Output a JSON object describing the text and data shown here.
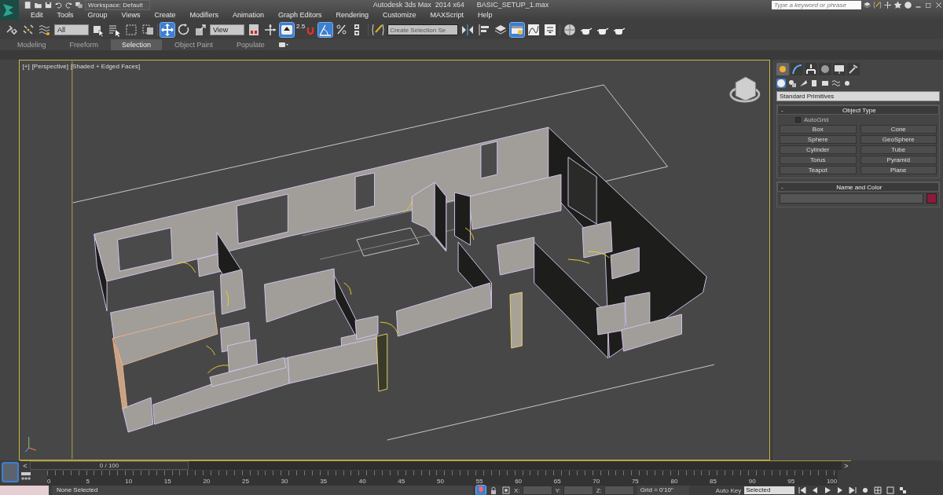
{
  "title_bar": {
    "workspace": "Workspace: Default",
    "app_title": "Autodesk 3ds Max  2014 x64",
    "file_name": "BASIC_SETUP_1.max",
    "search": {
      "placeholder": "Type a keyword or phrase"
    }
  },
  "menu": [
    "Edit",
    "Tools",
    "Group",
    "Views",
    "Create",
    "Modifiers",
    "Animation",
    "Graph Editors",
    "Rendering",
    "Customize",
    "MAXScript",
    "Help"
  ],
  "toolbar": {
    "selection_filter": "All",
    "reference_coordinate": "View",
    "snap_label": "2.5",
    "named_selection": {
      "placeholder": "Create Selection Se"
    },
    "select_and_move": {
      "on": true
    },
    "pivot_center": {
      "on": true
    },
    "angle_snap": {
      "on": true
    },
    "scene_explorer": {
      "on": true
    }
  },
  "ribbon_tabs": [
    {
      "label": "Modeling",
      "selected": false
    },
    {
      "label": "Freeform",
      "selected": false
    },
    {
      "label": "Selection",
      "selected": true
    },
    {
      "label": "Object Paint",
      "selected": false
    },
    {
      "label": "Populate",
      "selected": false
    }
  ],
  "viewport": {
    "labels": [
      "[+]",
      "[Perspective]",
      "[Shaded + Edged Faces]"
    ],
    "active": true
  },
  "command_panel": {
    "tabs": [
      {
        "selected": true
      },
      {
        "selected": false
      },
      {
        "selected": false
      },
      {
        "selected": false
      },
      {
        "selected": false
      },
      {
        "selected": false
      }
    ],
    "categories": [
      {
        "selected": true
      },
      {
        "selected": false
      },
      {
        "selected": false
      },
      {
        "selected": false
      },
      {
        "selected": false
      },
      {
        "selected": false
      },
      {
        "selected": false
      }
    ],
    "object_class": "Standard Primitives",
    "object_type": {
      "toggle": "-",
      "title": "Object Type",
      "autogrid": {
        "label": "AutoGrid",
        "checked": false
      },
      "buttons": [
        "Box",
        "Cone",
        "Sphere",
        "GeoSphere",
        "Cylinder",
        "Tube",
        "Torus",
        "Pyramid",
        "Teapot",
        "Plane"
      ]
    },
    "name_and_color": {
      "toggle": "-",
      "title": "Name and Color",
      "color": "#8c1a3c"
    }
  },
  "time_slider": {
    "previous": "<",
    "frame": "0 / 100",
    "next": ">",
    "ticks": [
      "0",
      "5",
      "10",
      "15",
      "20",
      "25",
      "30",
      "35",
      "40",
      "45",
      "50",
      "55",
      "60",
      "65",
      "70",
      "75",
      "80",
      "85",
      "90",
      "95",
      "100"
    ]
  },
  "status_bar": {
    "selection": "None Selected",
    "coordinates": [
      "X:",
      "Y:",
      "Z:"
    ],
    "grid": "Grid = 0'10\"",
    "auto_key": "Auto Key",
    "key_filter": "Selected"
  }
}
